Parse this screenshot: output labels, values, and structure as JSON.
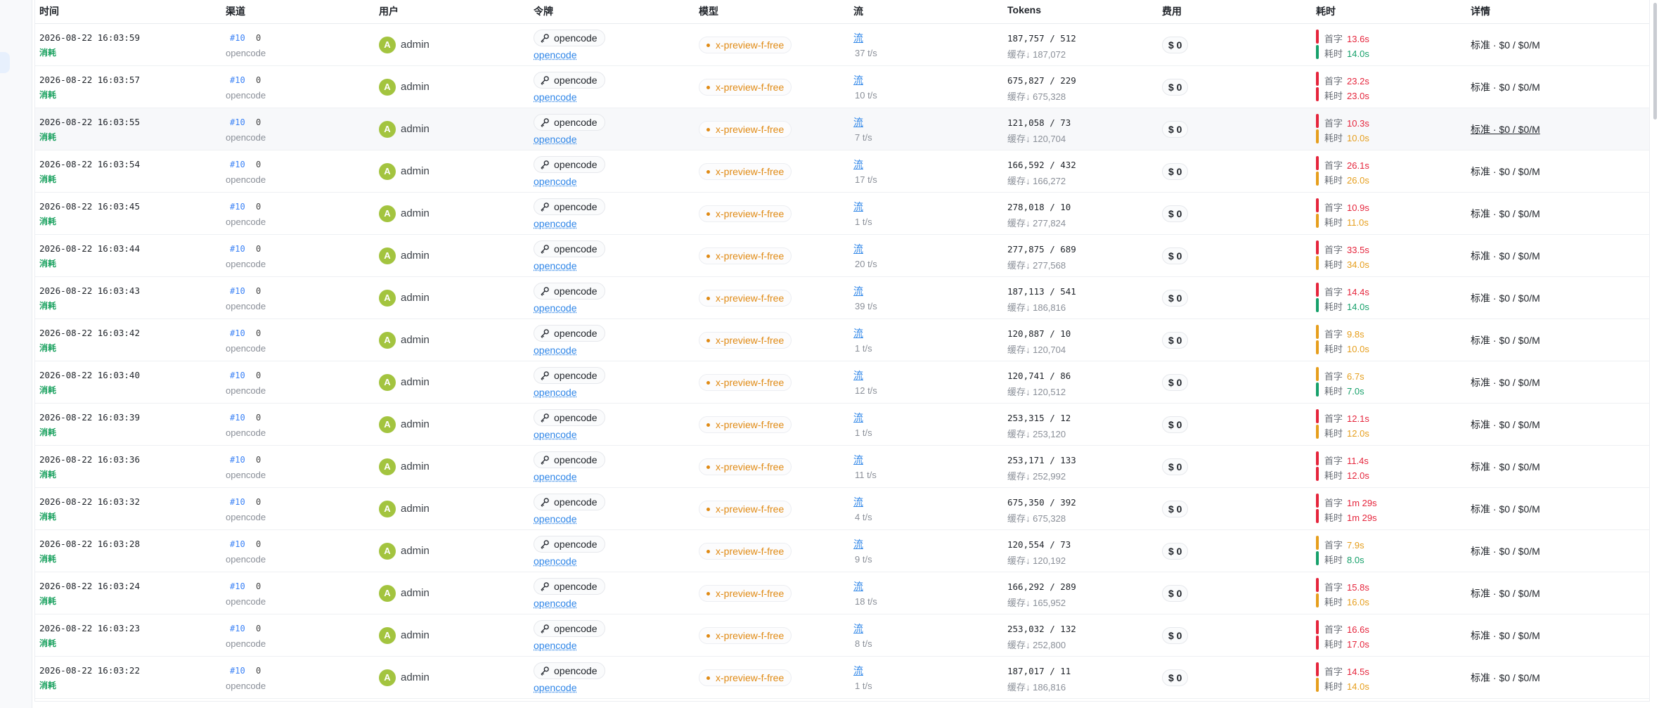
{
  "columns": [
    "时间",
    "渠道",
    "用户",
    "令牌",
    "模型",
    "流",
    "Tokens",
    "费用",
    "耗时",
    "详情"
  ],
  "colors": {
    "red": "#e5243b",
    "orange": "#e69e1c",
    "green": "#16a06a"
  },
  "rows": [
    {
      "time": "2026-08-22 16:03:59",
      "kind": "消耗",
      "channel_id": "#10",
      "channel_extra": "0",
      "channel_name": "opencode",
      "avatar": "A",
      "user": "admin",
      "token": "opencode",
      "token_link": "opencode",
      "model": "x-preview-f-free",
      "stream": "流",
      "rate": "37 t/s",
      "tokens": "187,757 / 512",
      "cache": "缓存↓ 187,072",
      "cost": "$ 0",
      "first_label": "首字",
      "first_value": "13.6s",
      "first_level": "red",
      "total_label": "耗时",
      "total_value": "14.0s",
      "total_level": "green",
      "detail": "标准 · $0 / $0/M"
    },
    {
      "time": "2026-08-22 16:03:57",
      "kind": "消耗",
      "channel_id": "#10",
      "channel_extra": "0",
      "channel_name": "opencode",
      "avatar": "A",
      "user": "admin",
      "token": "opencode",
      "token_link": "opencode",
      "model": "x-preview-f-free",
      "stream": "流",
      "rate": "10 t/s",
      "tokens": "675,827 / 229",
      "cache": "缓存↓ 675,328",
      "cost": "$ 0",
      "first_label": "首字",
      "first_value": "23.2s",
      "first_level": "red",
      "total_label": "耗时",
      "total_value": "23.0s",
      "total_level": "red",
      "detail": "标准 · $0 / $0/M"
    },
    {
      "time": "2026-08-22 16:03:55",
      "kind": "消耗",
      "channel_id": "#10",
      "channel_extra": "0",
      "channel_name": "opencode",
      "avatar": "A",
      "user": "admin",
      "token": "opencode",
      "token_link": "opencode",
      "model": "x-preview-f-free",
      "stream": "流",
      "rate": "7 t/s",
      "tokens": "121,058 / 73",
      "cache": "缓存↓ 120,704",
      "cost": "$ 0",
      "first_label": "首字",
      "first_value": "10.3s",
      "first_level": "red",
      "total_label": "耗时",
      "total_value": "10.0s",
      "total_level": "orange",
      "detail": "标准 · $0 / $0/M",
      "highlight": true
    },
    {
      "time": "2026-08-22 16:03:54",
      "kind": "消耗",
      "channel_id": "#10",
      "channel_extra": "0",
      "channel_name": "opencode",
      "avatar": "A",
      "user": "admin",
      "token": "opencode",
      "token_link": "opencode",
      "model": "x-preview-f-free",
      "stream": "流",
      "rate": "17 t/s",
      "tokens": "166,592 / 432",
      "cache": "缓存↓ 166,272",
      "cost": "$ 0",
      "first_label": "首字",
      "first_value": "26.1s",
      "first_level": "red",
      "total_label": "耗时",
      "total_value": "26.0s",
      "total_level": "orange",
      "detail": "标准 · $0 / $0/M"
    },
    {
      "time": "2026-08-22 16:03:45",
      "kind": "消耗",
      "channel_id": "#10",
      "channel_extra": "0",
      "channel_name": "opencode",
      "avatar": "A",
      "user": "admin",
      "token": "opencode",
      "token_link": "opencode",
      "model": "x-preview-f-free",
      "stream": "流",
      "rate": "1 t/s",
      "tokens": "278,018 / 10",
      "cache": "缓存↓ 277,824",
      "cost": "$ 0",
      "first_label": "首字",
      "first_value": "10.9s",
      "first_level": "red",
      "total_label": "耗时",
      "total_value": "11.0s",
      "total_level": "orange",
      "detail": "标准 · $0 / $0/M"
    },
    {
      "time": "2026-08-22 16:03:44",
      "kind": "消耗",
      "channel_id": "#10",
      "channel_extra": "0",
      "channel_name": "opencode",
      "avatar": "A",
      "user": "admin",
      "token": "opencode",
      "token_link": "opencode",
      "model": "x-preview-f-free",
      "stream": "流",
      "rate": "20 t/s",
      "tokens": "277,875 / 689",
      "cache": "缓存↓ 277,568",
      "cost": "$ 0",
      "first_label": "首字",
      "first_value": "33.5s",
      "first_level": "red",
      "total_label": "耗时",
      "total_value": "34.0s",
      "total_level": "orange",
      "detail": "标准 · $0 / $0/M"
    },
    {
      "time": "2026-08-22 16:03:43",
      "kind": "消耗",
      "channel_id": "#10",
      "channel_extra": "0",
      "channel_name": "opencode",
      "avatar": "A",
      "user": "admin",
      "token": "opencode",
      "token_link": "opencode",
      "model": "x-preview-f-free",
      "stream": "流",
      "rate": "39 t/s",
      "tokens": "187,113 / 541",
      "cache": "缓存↓ 186,816",
      "cost": "$ 0",
      "first_label": "首字",
      "first_value": "14.4s",
      "first_level": "red",
      "total_label": "耗时",
      "total_value": "14.0s",
      "total_level": "green",
      "detail": "标准 · $0 / $0/M"
    },
    {
      "time": "2026-08-22 16:03:42",
      "kind": "消耗",
      "channel_id": "#10",
      "channel_extra": "0",
      "channel_name": "opencode",
      "avatar": "A",
      "user": "admin",
      "token": "opencode",
      "token_link": "opencode",
      "model": "x-preview-f-free",
      "stream": "流",
      "rate": "1 t/s",
      "tokens": "120,887 / 10",
      "cache": "缓存↓ 120,704",
      "cost": "$ 0",
      "first_label": "首字",
      "first_value": "9.8s",
      "first_level": "orange",
      "total_label": "耗时",
      "total_value": "10.0s",
      "total_level": "orange",
      "detail": "标准 · $0 / $0/M"
    },
    {
      "time": "2026-08-22 16:03:40",
      "kind": "消耗",
      "channel_id": "#10",
      "channel_extra": "0",
      "channel_name": "opencode",
      "avatar": "A",
      "user": "admin",
      "token": "opencode",
      "token_link": "opencode",
      "model": "x-preview-f-free",
      "stream": "流",
      "rate": "12 t/s",
      "tokens": "120,741 / 86",
      "cache": "缓存↓ 120,512",
      "cost": "$ 0",
      "first_label": "首字",
      "first_value": "6.7s",
      "first_level": "orange",
      "total_label": "耗时",
      "total_value": "7.0s",
      "total_level": "green",
      "detail": "标准 · $0 / $0/M"
    },
    {
      "time": "2026-08-22 16:03:39",
      "kind": "消耗",
      "channel_id": "#10",
      "channel_extra": "0",
      "channel_name": "opencode",
      "avatar": "A",
      "user": "admin",
      "token": "opencode",
      "token_link": "opencode",
      "model": "x-preview-f-free",
      "stream": "流",
      "rate": "1 t/s",
      "tokens": "253,315 / 12",
      "cache": "缓存↓ 253,120",
      "cost": "$ 0",
      "first_label": "首字",
      "first_value": "12.1s",
      "first_level": "red",
      "total_label": "耗时",
      "total_value": "12.0s",
      "total_level": "orange",
      "detail": "标准 · $0 / $0/M"
    },
    {
      "time": "2026-08-22 16:03:36",
      "kind": "消耗",
      "channel_id": "#10",
      "channel_extra": "0",
      "channel_name": "opencode",
      "avatar": "A",
      "user": "admin",
      "token": "opencode",
      "token_link": "opencode",
      "model": "x-preview-f-free",
      "stream": "流",
      "rate": "11 t/s",
      "tokens": "253,171 / 133",
      "cache": "缓存↓ 252,992",
      "cost": "$ 0",
      "first_label": "首字",
      "first_value": "11.4s",
      "first_level": "red",
      "total_label": "耗时",
      "total_value": "12.0s",
      "total_level": "red",
      "detail": "标准 · $0 / $0/M"
    },
    {
      "time": "2026-08-22 16:03:32",
      "kind": "消耗",
      "channel_id": "#10",
      "channel_extra": "0",
      "channel_name": "opencode",
      "avatar": "A",
      "user": "admin",
      "token": "opencode",
      "token_link": "opencode",
      "model": "x-preview-f-free",
      "stream": "流",
      "rate": "4 t/s",
      "tokens": "675,350 / 392",
      "cache": "缓存↓ 675,328",
      "cost": "$ 0",
      "first_label": "首字",
      "first_value": "1m 29s",
      "first_level": "red",
      "total_label": "耗时",
      "total_value": "1m 29s",
      "total_level": "red",
      "detail": "标准 · $0 / $0/M"
    },
    {
      "time": "2026-08-22 16:03:28",
      "kind": "消耗",
      "channel_id": "#10",
      "channel_extra": "0",
      "channel_name": "opencode",
      "avatar": "A",
      "user": "admin",
      "token": "opencode",
      "token_link": "opencode",
      "model": "x-preview-f-free",
      "stream": "流",
      "rate": "9 t/s",
      "tokens": "120,554 / 73",
      "cache": "缓存↓ 120,192",
      "cost": "$ 0",
      "first_label": "首字",
      "first_value": "7.9s",
      "first_level": "orange",
      "total_label": "耗时",
      "total_value": "8.0s",
      "total_level": "green",
      "detail": "标准 · $0 / $0/M"
    },
    {
      "time": "2026-08-22 16:03:24",
      "kind": "消耗",
      "channel_id": "#10",
      "channel_extra": "0",
      "channel_name": "opencode",
      "avatar": "A",
      "user": "admin",
      "token": "opencode",
      "token_link": "opencode",
      "model": "x-preview-f-free",
      "stream": "流",
      "rate": "18 t/s",
      "tokens": "166,292 / 289",
      "cache": "缓存↓ 165,952",
      "cost": "$ 0",
      "first_label": "首字",
      "first_value": "15.8s",
      "first_level": "red",
      "total_label": "耗时",
      "total_value": "16.0s",
      "total_level": "orange",
      "detail": "标准 · $0 / $0/M"
    },
    {
      "time": "2026-08-22 16:03:23",
      "kind": "消耗",
      "channel_id": "#10",
      "channel_extra": "0",
      "channel_name": "opencode",
      "avatar": "A",
      "user": "admin",
      "token": "opencode",
      "token_link": "opencode",
      "model": "x-preview-f-free",
      "stream": "流",
      "rate": "8 t/s",
      "tokens": "253,032 / 132",
      "cache": "缓存↓ 252,800",
      "cost": "$ 0",
      "first_label": "首字",
      "first_value": "16.6s",
      "first_level": "red",
      "total_label": "耗时",
      "total_value": "17.0s",
      "total_level": "red",
      "detail": "标准 · $0 / $0/M"
    },
    {
      "time": "2026-08-22 16:03:22",
      "kind": "消耗",
      "channel_id": "#10",
      "channel_extra": "0",
      "channel_name": "opencode",
      "avatar": "A",
      "user": "admin",
      "token": "opencode",
      "token_link": "opencode",
      "model": "x-preview-f-free",
      "stream": "流",
      "rate": "1 t/s",
      "tokens": "187,017 / 11",
      "cache": "缓存↓ 186,816",
      "cost": "$ 0",
      "first_label": "首字",
      "first_value": "14.5s",
      "first_level": "red",
      "total_label": "耗时",
      "total_value": "14.0s",
      "total_level": "orange",
      "detail": "标准 · $0 / $0/M"
    }
  ]
}
